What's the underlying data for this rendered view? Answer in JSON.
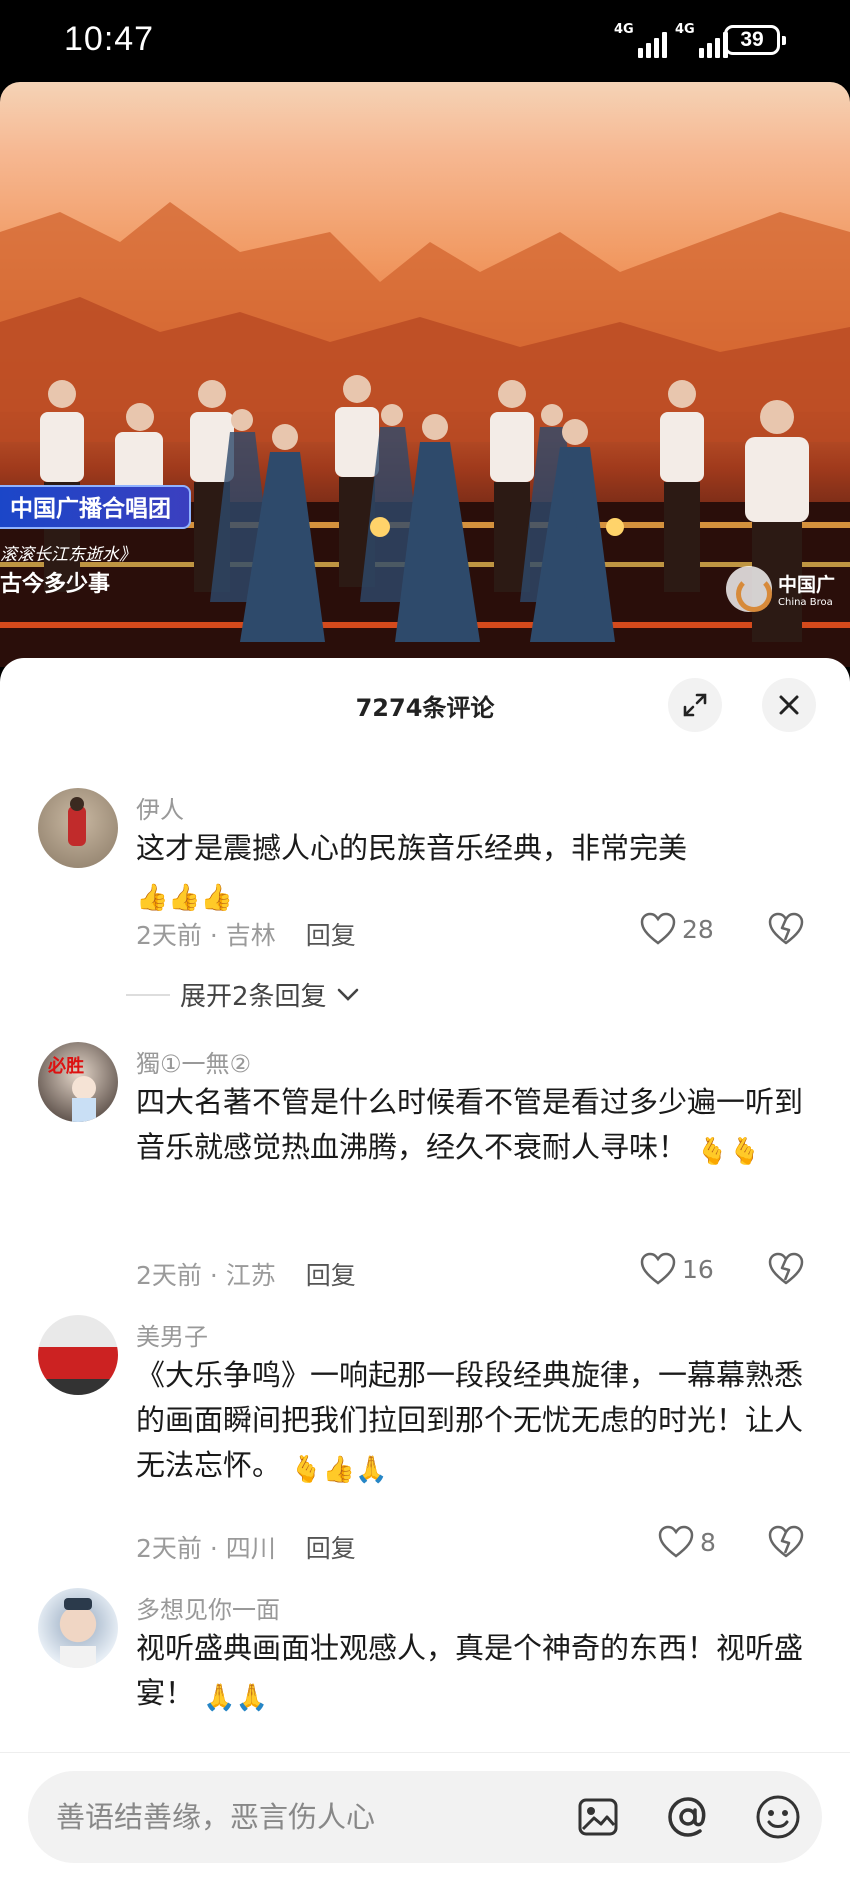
{
  "status_bar": {
    "time": "10:47",
    "network_1": "4G",
    "network_2": "4G",
    "battery": "39"
  },
  "video": {
    "overlay_title": "中国广播合唱团",
    "overlay_sub1": "滚滚长江东逝水》",
    "overlay_sub2": "古今多少事",
    "logo_text": "中国广",
    "logo_sub": "China Broa"
  },
  "comments_panel": {
    "title": "7274条评论",
    "comments": [
      {
        "name": "伊人",
        "text": "这才是震撼人心的民族音乐经典，非常完美",
        "emojis": "👍👍👍",
        "time": "2天前",
        "location": "吉林",
        "reply": "回复",
        "likes": "28"
      },
      {
        "name": "獨①一無②",
        "text": "四大名著不管是什么时候看不管是看过多少遍一听到音乐就感觉热血沸腾，经久不衰耐人寻味！",
        "emojis": "🫰🫰",
        "time": "2天前",
        "location": "江苏",
        "reply": "回复",
        "likes": "16"
      },
      {
        "name": "美男子",
        "text": "《大乐争鸣》一响起那一段段经典旋律，一幕幕熟悉的画面瞬间把我们拉回到那个无忧无虑的时光！让人无法忘怀。",
        "emojis": "🫰👍🙏",
        "time": "2天前",
        "location": "四川",
        "reply": "回复",
        "likes": "8"
      },
      {
        "name": "多想见你一面",
        "text": "视听盛典画面壮观感人，真是个神奇的东西！视听盛宴！",
        "emojis": "🙏🙏",
        "time": "",
        "location": "",
        "reply": "",
        "likes": ""
      }
    ],
    "expand_replies": "展开2条回复"
  },
  "input": {
    "placeholder": "善语结善缘，恶言伤人心"
  },
  "colors": {
    "accent_badge": "#1b46c8",
    "text_primary": "#1a1a1a",
    "text_secondary": "#999999"
  },
  "icons": [
    "expand-icon",
    "close-icon",
    "heart-icon",
    "dislike-heart-icon",
    "chevron-down-icon",
    "image-icon",
    "at-icon",
    "emoji-icon"
  ]
}
